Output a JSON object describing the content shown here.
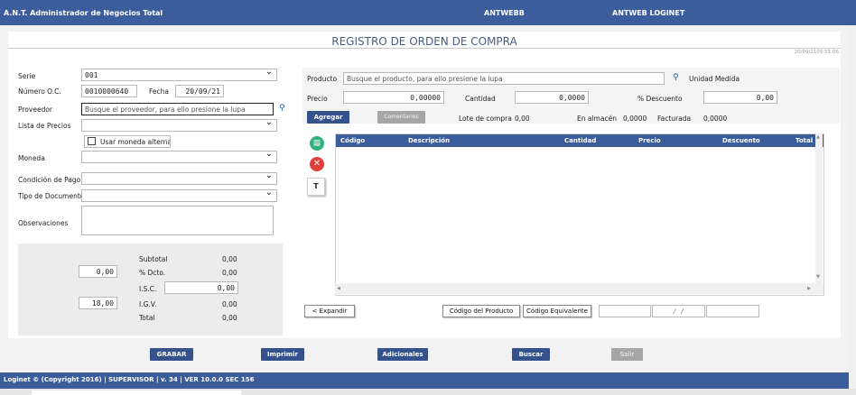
{
  "header": {
    "app_title": "A.N.T. Administrador de Negocios Total",
    "server": "ANTWEBB",
    "module": "ANTWEB LOGINET"
  },
  "page": {
    "title": "REGISTRO DE ORDEN DE COMPRA",
    "date_stamp": "20/09/2109:55:06"
  },
  "form": {
    "serie_label": "Serie",
    "serie_value": "001",
    "numero_label": "Número O.C.",
    "numero_value": "0010000640",
    "fecha_label": "Fecha",
    "fecha_value": "20/09/21",
    "proveedor_label": "Proveedor",
    "proveedor_placeholder": "Busque el proveedor, para ello presione la lupa",
    "lista_label": "Lista de Precios",
    "lista_value": "",
    "alterna_label": "Usar moneda alterna",
    "moneda_label": "Moneda",
    "moneda_value": "",
    "condicion_label": "Condición de Pago",
    "condicion_value": "",
    "tipo_label": "Tipo de Documento",
    "tipo_value": "",
    "obs_label": "Observaciones",
    "obs_value": ""
  },
  "totals": {
    "subtotal_label": "Subtotal",
    "subtotal_value": "0,00",
    "dcto_pct": "0,00",
    "dcto_label": "% Dcto.",
    "dcto_value": "0,00",
    "isc_label": "I.S.C.",
    "isc_value": "0,00",
    "igv_pct": "18,00",
    "igv_label": "I.G.V.",
    "igv_value": "0,00",
    "total_label": "Total",
    "total_value": "0,00"
  },
  "product": {
    "label": "Producto",
    "placeholder": "Busque el producto, para ello presione la lupa",
    "unidad_label": "Unidad Medida",
    "precio_label": "Precio",
    "precio_value": "0,00000",
    "cantidad_label": "Cantidad",
    "cantidad_value": "0,0000",
    "descuento_label": "% Descuento",
    "descuento_value": "0,00",
    "agregar_label": "Agregar",
    "comentarios_label": "Comentarios",
    "lote_label": "Lote de compra",
    "lote_value": "0,00",
    "almacen_label": "En almacén",
    "almacen_value": "0,0000",
    "facturada_label": "Facturada",
    "facturada_value": "0,0000"
  },
  "grid": {
    "columns": [
      "Código",
      "Descripción",
      "Cantidad",
      "Precio",
      "Descuento",
      "Total"
    ]
  },
  "bottom": {
    "expandir_label": "< Expandir",
    "codigo_producto_label": "Código del Producto",
    "codigo_equivalente_label": "Código Equivalente",
    "date_sep": "/ /"
  },
  "actions": {
    "grabar": "GRABAR",
    "imprimir": "Imprimir",
    "adicionales": "Adicionales",
    "buscar": "Buscar",
    "salir": "Salir"
  },
  "footer": {
    "text": "Loginet © (Copyright 2016) | SUPERVISOR | v. 34 | VER 10.0.0 SEC 156"
  },
  "colors": {
    "brand": "#3c5d9c",
    "button": "#36528d",
    "disabled": "#a6a6a6",
    "add_icon": "#2fb37c",
    "delete_icon": "#e0403a"
  }
}
